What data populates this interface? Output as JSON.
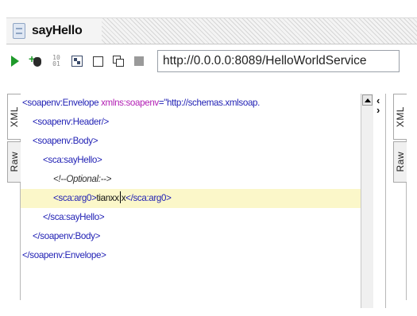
{
  "window": {
    "title": "sayHello"
  },
  "toolbar": {
    "submit_icon": "play-icon",
    "add_wss_icon": "add-wss-header-icon",
    "binary_icon": "binary-icon",
    "binary_text": "10 01",
    "endpoint_url": "http://0.0.0.0:8089/HelloWorldService"
  },
  "request_panel": {
    "tabs": {
      "xml": "XML",
      "raw": "Raw"
    },
    "xml_lines": [
      {
        "indent": 0,
        "parts": [
          [
            "tag",
            "<soapenv:Envelope "
          ],
          [
            "attr",
            "xmlns:soapenv"
          ],
          [
            "tag",
            "="
          ],
          [
            "str",
            "\"http://schemas.xmlsoap."
          ]
        ]
      },
      {
        "indent": 1,
        "parts": [
          [
            "tag",
            "<soapenv:Header/>"
          ]
        ]
      },
      {
        "indent": 1,
        "parts": [
          [
            "tag",
            "<soapenv:Body>"
          ]
        ]
      },
      {
        "indent": 2,
        "parts": [
          [
            "tag",
            "<sca:sayHello>"
          ]
        ]
      },
      {
        "indent": 3,
        "parts": [
          [
            "cmt",
            "<!--Optional:-->"
          ]
        ]
      },
      {
        "indent": 3,
        "highlight": true,
        "caret_after": 1,
        "parts": [
          [
            "tag",
            "<sca:arg0>"
          ],
          [
            "txt",
            "tianxx"
          ],
          [
            "txt",
            "x"
          ],
          [
            "tag",
            "</sca:arg0>"
          ]
        ]
      },
      {
        "indent": 2,
        "parts": [
          [
            "tag",
            "</sca:sayHello>"
          ]
        ]
      },
      {
        "indent": 1,
        "parts": [
          [
            "tag",
            "</soapenv:Body>"
          ]
        ]
      },
      {
        "indent": 0,
        "parts": [
          [
            "tag",
            "</soapenv:Envelope>"
          ]
        ]
      }
    ]
  },
  "response_panel": {
    "tabs": {
      "xml": "XML",
      "raw": "Raw"
    }
  },
  "colors": {
    "tag": "#1f1fb4",
    "attribute": "#b21fb4",
    "highlight_line": "#fbf7c9",
    "play": "#1f9a2a"
  }
}
